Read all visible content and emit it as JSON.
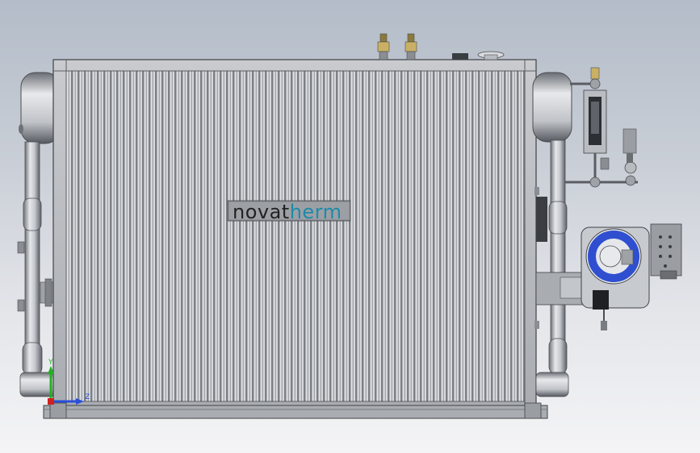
{
  "logo": {
    "part1": "novat",
    "part2": "herm",
    "color_dark": "#222222",
    "color_accent": "#1e8aa8"
  },
  "triad": {
    "y_label": "Y",
    "z_label": "Z",
    "y_color": "#22b022",
    "z_color": "#2a4fd8"
  },
  "colors": {
    "background_top": "#b3bcc8",
    "background_bottom": "#f4f4f6",
    "fin_light": "#d2d4d8",
    "fin_dark": "#7c7f85",
    "burner_blue": "#2f4fd0"
  }
}
